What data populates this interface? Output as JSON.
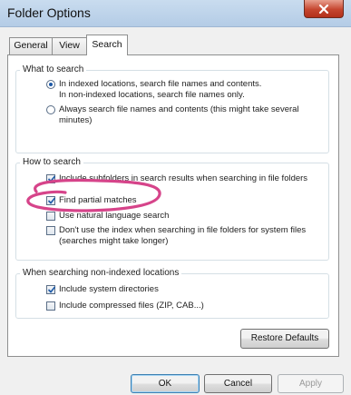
{
  "window": {
    "title": "Folder Options",
    "close_glyph": "✕"
  },
  "tabs": [
    {
      "label": "General",
      "selected": false
    },
    {
      "label": "View",
      "selected": false
    },
    {
      "label": "Search",
      "selected": true
    }
  ],
  "what_to_search": {
    "label": "What to search",
    "options": [
      {
        "line1": "In indexed locations, search file names and contents.",
        "line2": "In non-indexed locations, search file names only.",
        "selected": true
      },
      {
        "line1": "Always search file names and contents (this might take several",
        "line2": "minutes)",
        "selected": false
      }
    ]
  },
  "how_to_search": {
    "label": "How to search",
    "options": [
      {
        "line1": "Include subfolders in search results when searching in file folders",
        "line2": "",
        "checked": true
      },
      {
        "line1": "Find partial matches",
        "line2": "",
        "checked": true
      },
      {
        "line1": "Use natural language search",
        "line2": "",
        "checked": false
      },
      {
        "line1": "Don't use the index when searching in file folders for system files",
        "line2": "(searches might take longer)",
        "checked": false
      }
    ]
  },
  "non_indexed": {
    "label": "When searching non-indexed locations",
    "options": [
      {
        "line1": "Include system directories",
        "checked": true
      },
      {
        "line1": "Include compressed files (ZIP, CAB...)",
        "checked": false
      }
    ]
  },
  "buttons": {
    "restore_defaults": "Restore Defaults",
    "ok": "OK",
    "cancel": "Cancel",
    "apply": "Apply"
  },
  "colors": {
    "annotation": "#d6448a",
    "accent": "#1d5aa8"
  }
}
